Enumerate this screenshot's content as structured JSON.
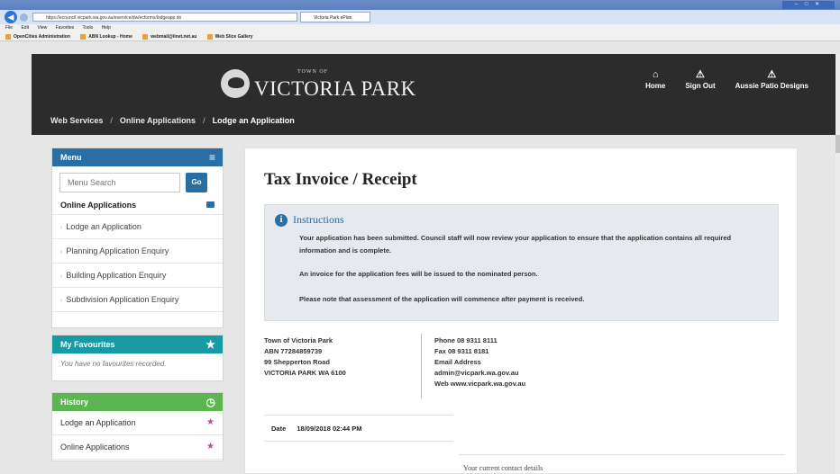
{
  "browser": {
    "address": "https://ecouncil.vicpark.wa.gov.au/eservice/dw/ecforms/lodgeapp.do",
    "tab_title": "Victoria Park ePlan",
    "menus": [
      "File",
      "Edit",
      "View",
      "Favorites",
      "Tools",
      "Help"
    ],
    "favorites": [
      "OpenCities Administration",
      "ABN Lookup - Home",
      "webmail@iinet.net.au",
      "Web Slice Gallery"
    ]
  },
  "header": {
    "logo_small": "TOWN OF",
    "logo_main": "VICTORIA PARK",
    "links": [
      {
        "icon": "⌂",
        "label": "Home"
      },
      {
        "icon": "⚠",
        "label": "Sign Out"
      },
      {
        "icon": "⚠",
        "label": "Aussie Patio Designs"
      }
    ],
    "breadcrumb": [
      "Web Services",
      "Online Applications",
      "Lodge an Application"
    ]
  },
  "sidebar": {
    "menu_title": "Menu",
    "search_placeholder": "Menu Search",
    "go_label": "Go",
    "section": "Online Applications",
    "items": [
      "Lodge an Application",
      "Planning Application Enquiry",
      "Building Application Enquiry",
      "Subdivision Application Enquiry"
    ],
    "favourites_title": "My Favourites",
    "favourites_empty": "You have no favourites recorded.",
    "history_title": "History",
    "history": [
      "Lodge an Application",
      "Online Applications"
    ]
  },
  "main": {
    "title": "Tax Invoice / Receipt",
    "instructions_title": "Instructions",
    "paragraphs": [
      "Your application has been submitted. Council staff will now review your application to ensure that the application contains all required information and is complete.",
      "An invoice for the application fees will be issued to the nominated person.",
      "Please note that assessment of the application will commence after payment is received."
    ],
    "address": [
      "Town of Victoria Park",
      "ABN 77284859739",
      "99 Shepperton Road",
      "VICTORIA PARK WA 6100"
    ],
    "contact": [
      "Phone 08 9311 8111",
      "Fax 08 9311 8181",
      "Email Address",
      "admin@vicpark.wa.gov.au",
      "Web www.vicpark.wa.gov.au"
    ],
    "date_label": "Date",
    "date_value": "18/09/2018 02:44 PM",
    "current_contact": "Your current contact details"
  }
}
